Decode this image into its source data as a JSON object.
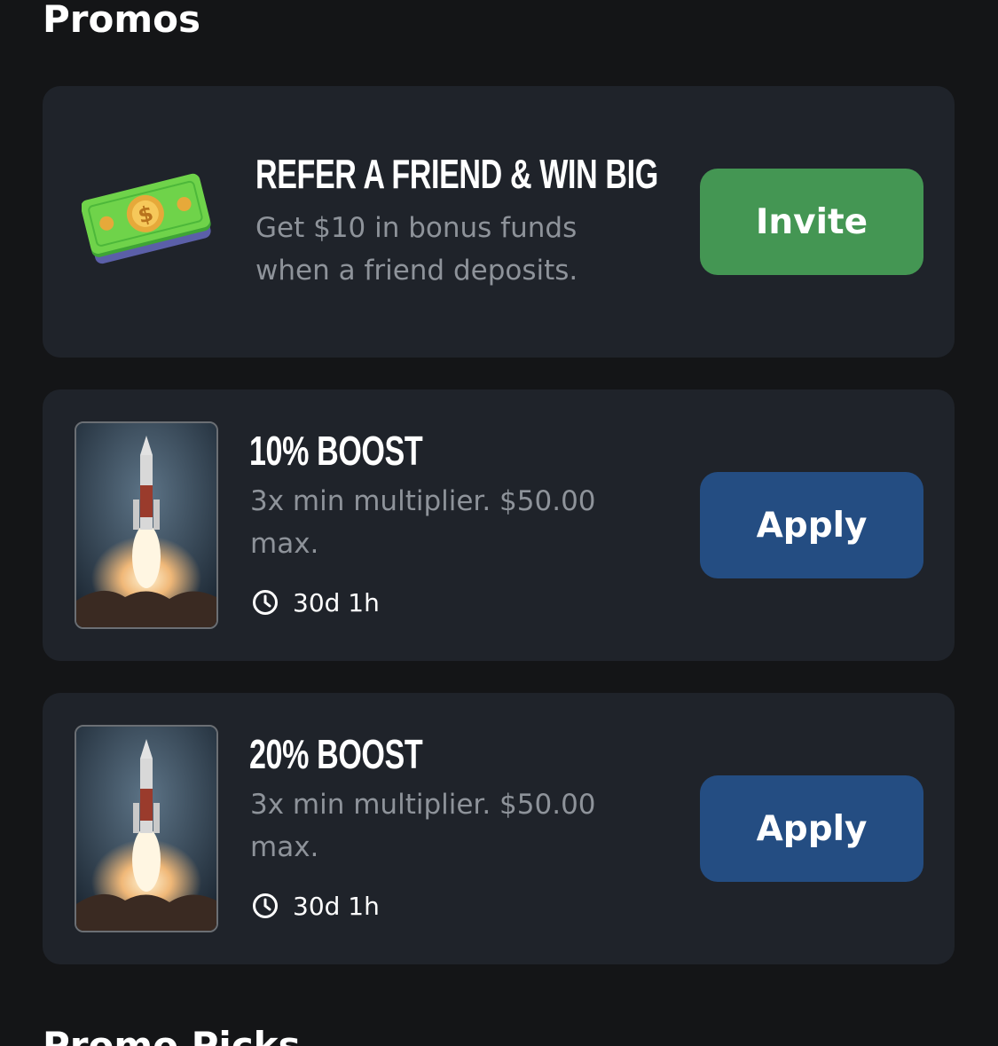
{
  "header": {
    "title": "Promos"
  },
  "refer_card": {
    "title": "REFER A FRIEND & WIN BIG",
    "description_line1": "Get $10 in bonus funds",
    "description_line2": "when a friend deposits.",
    "button_label": "Invite",
    "icon": "cash-bill-icon",
    "button_color": "#449653"
  },
  "boosts": [
    {
      "title": "10% BOOST",
      "description_line1": "3x min multiplier. $50.00",
      "description_line2": "max.",
      "timer": "30d 1h",
      "button_label": "Apply",
      "image": "rocket-launch-image",
      "button_color": "#244d82"
    },
    {
      "title": "20% BOOST",
      "description_line1": "3x min multiplier. $50.00",
      "description_line2": "max.",
      "timer": "30d 1h",
      "button_label": "Apply",
      "image": "rocket-launch-image",
      "button_color": "#244d82"
    }
  ],
  "next_section": {
    "title": "Promo Picks"
  },
  "colors": {
    "background": "#141517",
    "card": "#1f232a",
    "muted_text": "#8e939a"
  }
}
